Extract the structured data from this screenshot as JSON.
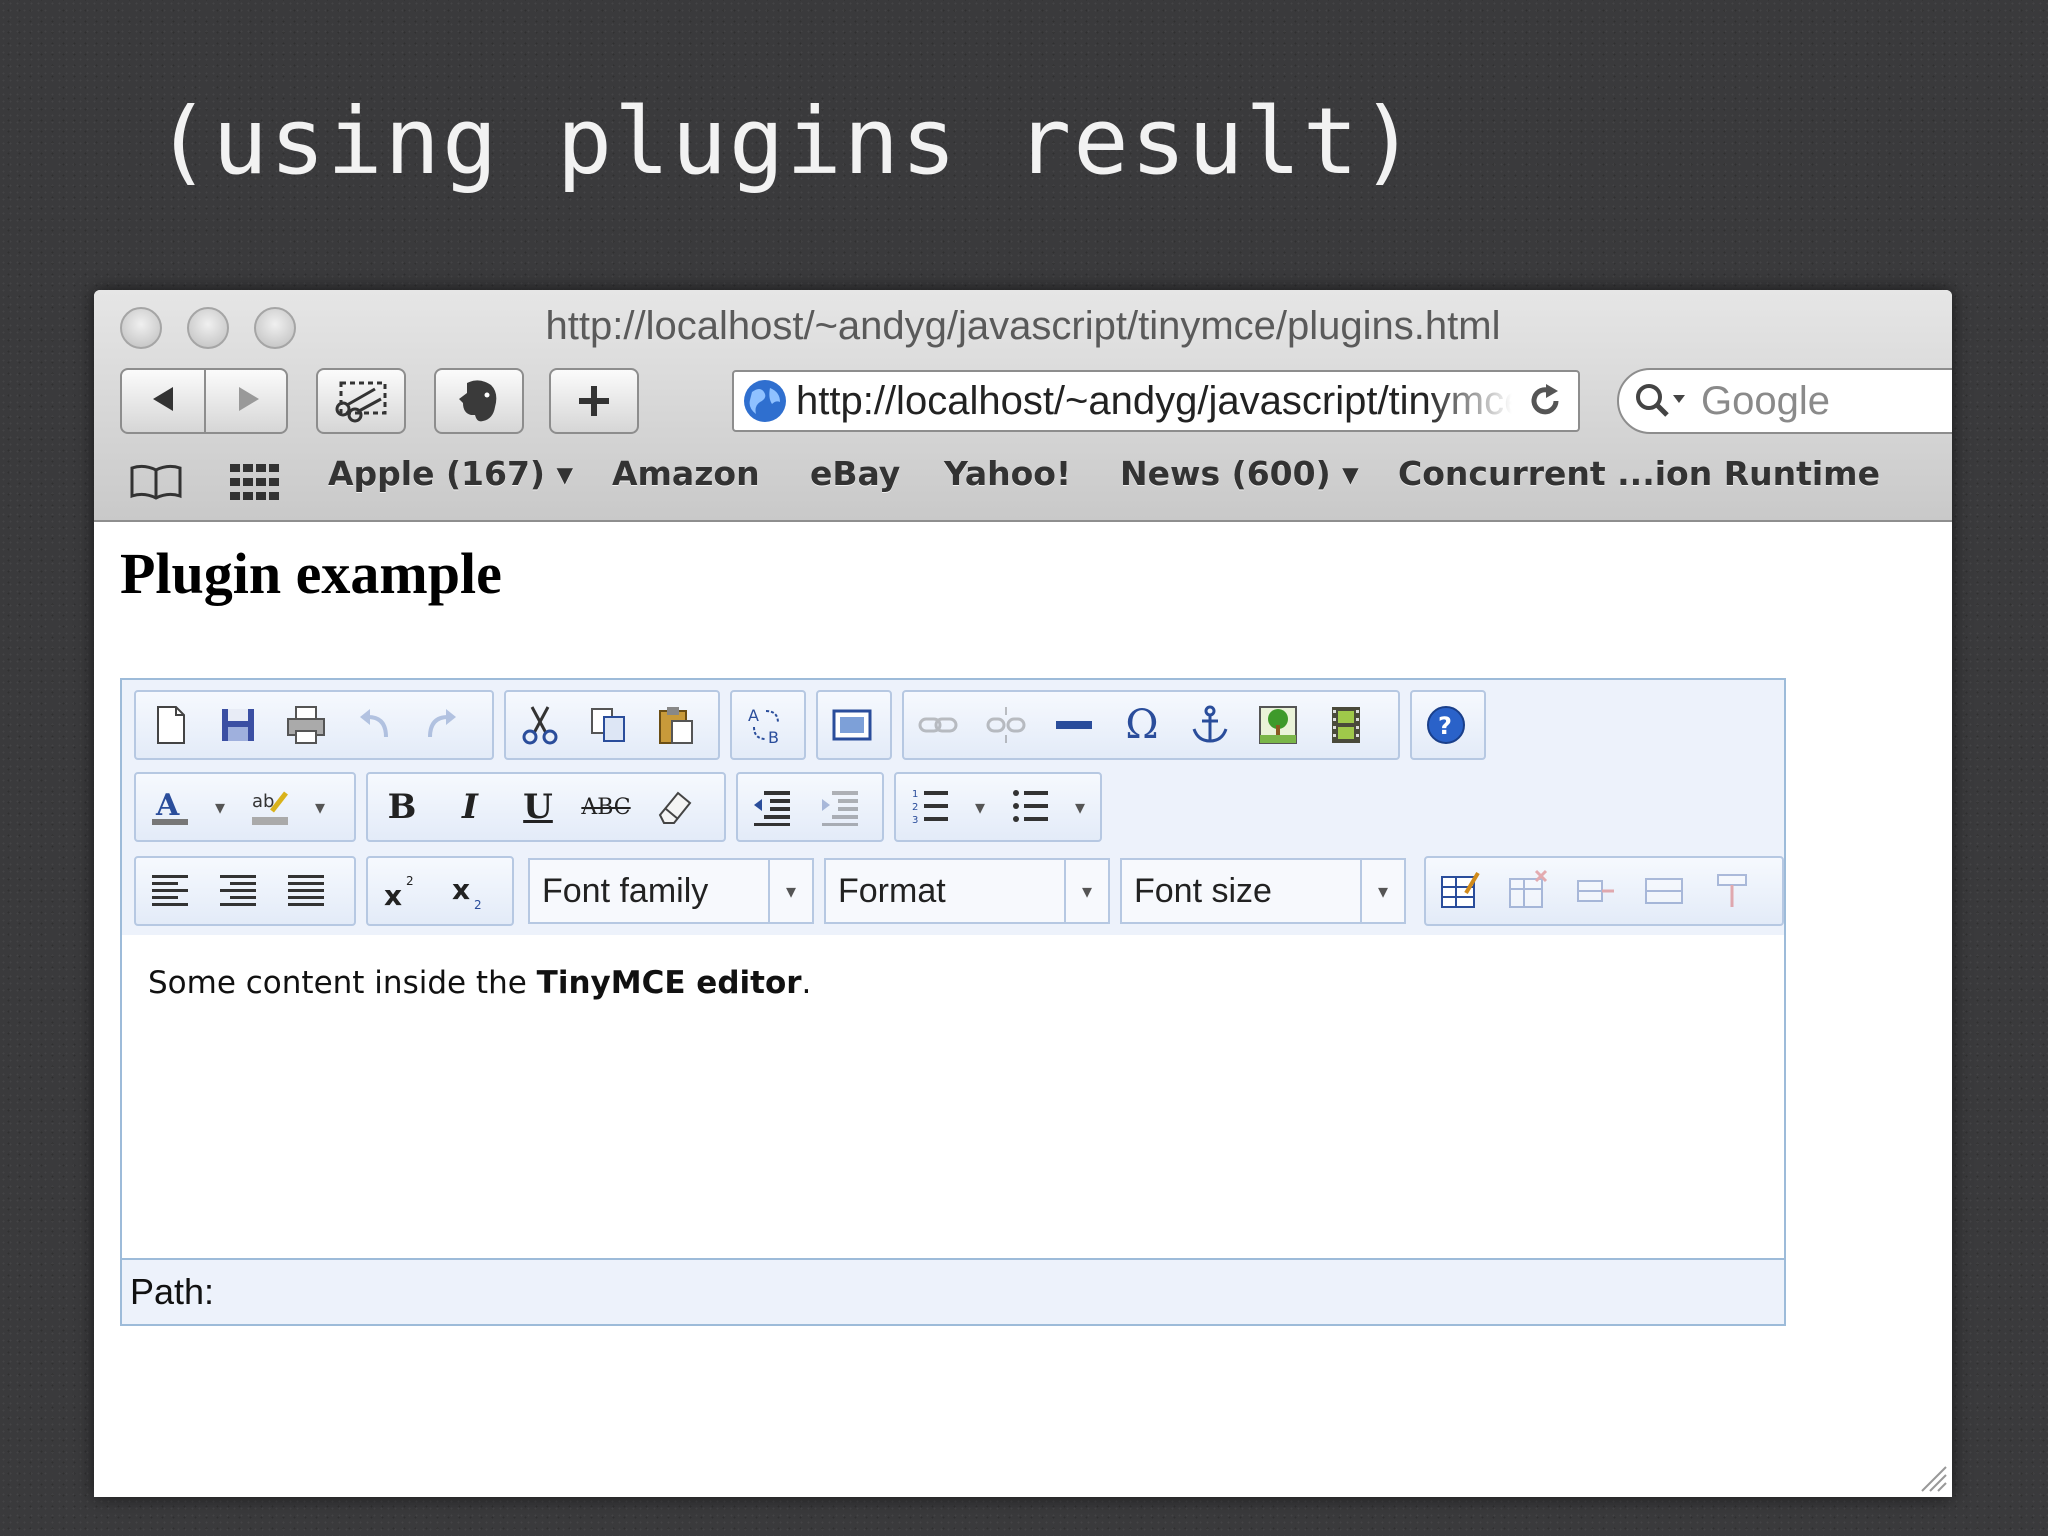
{
  "slide": {
    "title": "(using plugins result)"
  },
  "browser": {
    "window_title": "http://localhost/~andyg/javascript/tinymce/plugins.html",
    "address": "http://localhost/~andyg/javascript/tinymce/plugins.html",
    "search_placeholder": "Google",
    "bookmarks": [
      {
        "label": "Apple (167)",
        "has_menu": true
      },
      {
        "label": "Amazon"
      },
      {
        "label": "eBay"
      },
      {
        "label": "Yahoo!"
      },
      {
        "label": "News (600)",
        "has_menu": true
      },
      {
        "label": "Concurrent ...ion Runtime"
      }
    ]
  },
  "page": {
    "heading": "Plugin example",
    "editor": {
      "selects": {
        "font_family": "Font family",
        "format": "Format",
        "font_size": "Font size"
      },
      "content": {
        "before": "Some content inside the ",
        "bold": "TinyMCE editor",
        "after": "."
      },
      "path_label": "Path:"
    }
  }
}
